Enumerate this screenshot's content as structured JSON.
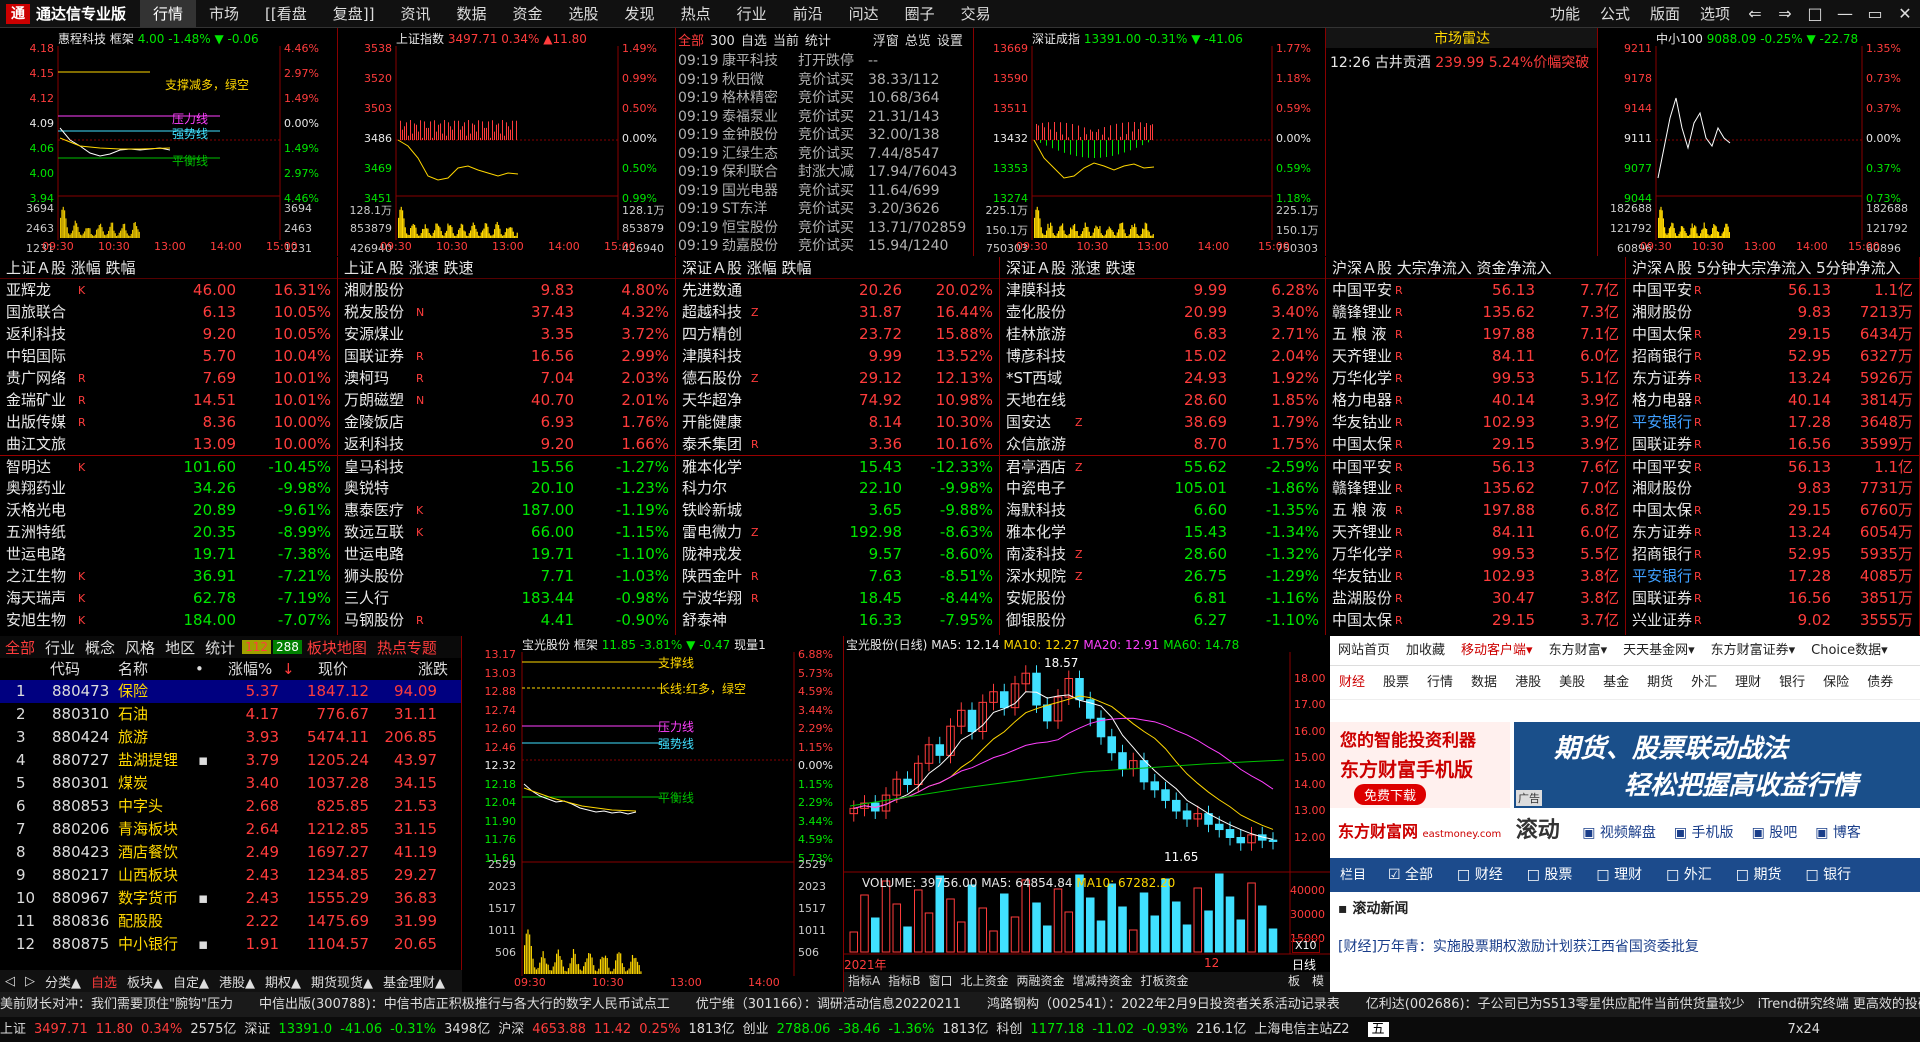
{
  "app": {
    "name": "通达信专业版"
  },
  "menu": [
    "行情",
    "市场",
    "[[看盘",
    "复盘]]",
    "资讯",
    "数据",
    "资金",
    "选股",
    "发现",
    "热点",
    "行业",
    "前沿",
    "问达",
    "圈子",
    "交易"
  ],
  "right_menu": [
    "功能",
    "公式",
    "版面",
    "选项"
  ],
  "win_buttons": [
    "⇐",
    "⇒",
    "□",
    "—",
    "▭",
    "✕"
  ],
  "panel1": {
    "name": "惠程科技",
    "tag": "框架",
    "price": "4.00",
    "chg": "-1.48%",
    "delta": "▼ -0.06",
    "note1": "支撑减多，绿空",
    "note2": "压力线",
    "note3": "强势线",
    "note4": "平衡线",
    "left_ticks": [
      "4.18",
      "4.15",
      "4.12",
      "4.09",
      "4.06",
      "4.00",
      "3.94",
      "3694",
      "2463",
      "1231"
    ],
    "right_ticks": [
      "4.46%",
      "2.97%",
      "1.49%",
      "0.00%",
      "1.49%",
      "2.97%",
      "4.46%",
      "3694",
      "2463",
      "1231"
    ],
    "times": [
      "09:30",
      "10:30",
      "13:00",
      "14:00",
      "15:00"
    ]
  },
  "panel2": {
    "name": "上证指数",
    "price": "3497.71",
    "chg": "0.34%",
    "delta": "▲11.80",
    "left_ticks": [
      "3538",
      "3520",
      "3503",
      "3486",
      "3469",
      "3451",
      "128.1万",
      "853879",
      "426940"
    ],
    "right_ticks": [
      "1.49%",
      "0.99%",
      "0.50%",
      "0.00%",
      "0.50%",
      "0.99%",
      "128.1万",
      "853879",
      "426940"
    ],
    "times": [
      "09:30",
      "10:30",
      "13:00",
      "14:00",
      "15:00"
    ]
  },
  "panel3": {
    "tabs": [
      "全部",
      "300",
      "自选",
      "当前",
      "统计"
    ],
    "tabs_right": [
      "浮窗",
      "总览",
      "设置"
    ],
    "rows": [
      [
        "09:19",
        "康平科技",
        "打开跌停",
        "--"
      ],
      [
        "09:19",
        "秋田微",
        "竞价试买",
        "38.33/112"
      ],
      [
        "09:19",
        "格林精密",
        "竞价试买",
        "10.68/364"
      ],
      [
        "09:19",
        "泰福泵业",
        "竞价试买",
        "21.31/143"
      ],
      [
        "09:19",
        "金钟股份",
        "竞价试买",
        "32.00/138"
      ],
      [
        "09:19",
        "汇绿生态",
        "竞价试买",
        "7.44/8547"
      ],
      [
        "09:19",
        "保利联合",
        "封涨大减",
        "17.94/76043"
      ],
      [
        "09:19",
        "国光电器",
        "竞价试买",
        "11.64/699"
      ],
      [
        "09:19",
        "ST东洋",
        "竞价试买",
        "3.20/3626"
      ],
      [
        "09:19",
        "恒宝股份",
        "竞价试买",
        "13.71/702859"
      ],
      [
        "09:19",
        "劲嘉股份",
        "竞价试买",
        "15.94/1240"
      ]
    ]
  },
  "panel4": {
    "name": "深证成指",
    "price": "13391.00",
    "chg": "-0.31%",
    "delta": "▼ -41.06",
    "left_ticks": [
      "13669",
      "13590",
      "13511",
      "13432",
      "13353",
      "13274",
      "225.1万",
      "150.1万",
      "750303"
    ],
    "right_ticks": [
      "1.77%",
      "1.18%",
      "0.59%",
      "0.00%",
      "0.59%",
      "1.18%",
      "225.1万",
      "150.1万",
      "750303"
    ],
    "times": [
      "09:30",
      "10:30",
      "13:00",
      "14:00",
      "15:00"
    ]
  },
  "panel5": {
    "title": "市场雷达",
    "time": "12:26",
    "name": "古井贡酒",
    "price": "239.99",
    "event": "5.24%价幅突破"
  },
  "panel6": {
    "name": "中小100",
    "price": "9088.09",
    "chg": "-0.25%",
    "delta": "▼ -22.78",
    "left_ticks": [
      "9211",
      "9178",
      "9144",
      "9111",
      "9077",
      "9044",
      "182688",
      "121792",
      "60896"
    ],
    "right_ticks": [
      "1.35%",
      "0.73%",
      "0.37%",
      "0.00%",
      "0.37%",
      "0.73%",
      "182688",
      "121792",
      "60896"
    ],
    "times": [
      "09:30",
      "10:30",
      "13:00",
      "14:00",
      "15:00"
    ]
  },
  "tables": [
    {
      "title": "上证Ａ股 涨幅 跌幅",
      "rows": [
        [
          "亚辉龙",
          "K",
          "46.00",
          "16.31%"
        ],
        [
          "国旅联合",
          "",
          "6.13",
          "10.05%"
        ],
        [
          "返利科技",
          "",
          "9.20",
          "10.05%"
        ],
        [
          "中铝国际",
          "",
          "5.70",
          "10.04%"
        ],
        [
          "贵广网络",
          "R",
          "7.69",
          "10.01%"
        ],
        [
          "金瑞矿业",
          "R",
          "14.51",
          "10.01%"
        ],
        [
          "出版传媒",
          "R",
          "8.36",
          "10.00%"
        ],
        [
          "曲江文旅",
          "",
          "13.09",
          "10.00%"
        ],
        [
          "智明达",
          "K",
          "101.60",
          "-10.45%"
        ],
        [
          "奥翔药业",
          "",
          "34.26",
          "-9.98%"
        ],
        [
          "沃格光电",
          "",
          "20.89",
          "-9.61%"
        ],
        [
          "五洲特纸",
          "",
          "20.35",
          "-8.99%"
        ],
        [
          "世运电路",
          "",
          "19.71",
          "-7.38%"
        ],
        [
          "之江生物",
          "K",
          "36.91",
          "-7.21%"
        ],
        [
          "海天瑞声",
          "K",
          "62.78",
          "-7.19%"
        ],
        [
          "安旭生物",
          "K",
          "184.00",
          "-7.07%"
        ]
      ]
    },
    {
      "title": "上证Ａ股 涨速 跌速",
      "rows": [
        [
          "湘财股份",
          "",
          "9.83",
          "4.80%"
        ],
        [
          "税友股份",
          "N",
          "37.43",
          "4.32%"
        ],
        [
          "安源煤业",
          "",
          "3.35",
          "3.72%"
        ],
        [
          "国联证券",
          "R",
          "16.56",
          "2.99%"
        ],
        [
          "澳柯玛",
          "R",
          "7.04",
          "2.03%"
        ],
        [
          "万朗磁塑",
          "N",
          "40.70",
          "2.01%"
        ],
        [
          "金陵饭店",
          "",
          "6.93",
          "1.76%"
        ],
        [
          "返利科技",
          "",
          "9.20",
          "1.66%"
        ],
        [
          "皇马科技",
          "",
          "15.56",
          "-1.27%"
        ],
        [
          "奥锐特",
          "",
          "20.10",
          "-1.23%"
        ],
        [
          "惠泰医疗",
          "K",
          "187.00",
          "-1.19%"
        ],
        [
          "致远互联",
          "K",
          "66.00",
          "-1.15%"
        ],
        [
          "世运电路",
          "",
          "19.71",
          "-1.10%"
        ],
        [
          "狮头股份",
          "",
          "7.71",
          "-1.03%"
        ],
        [
          "三人行",
          "",
          "183.44",
          "-0.98%"
        ],
        [
          "马钢股份",
          "R",
          "4.41",
          "-0.90%"
        ]
      ]
    },
    {
      "title": "深证Ａ股 涨幅 跌幅",
      "rows": [
        [
          "先进数通",
          "",
          "20.26",
          "20.02%"
        ],
        [
          "超越科技",
          "Z",
          "31.87",
          "16.44%"
        ],
        [
          "四方精创",
          "",
          "23.72",
          "15.88%"
        ],
        [
          "津膜科技",
          "",
          "9.99",
          "13.52%"
        ],
        [
          "德石股份",
          "Z",
          "29.12",
          "12.13%"
        ],
        [
          "天华超净",
          "",
          "74.92",
          "10.98%"
        ],
        [
          "开能健康",
          "",
          "8.14",
          "10.30%"
        ],
        [
          "泰禾集团",
          "R",
          "3.36",
          "10.16%"
        ],
        [
          "雅本化学",
          "",
          "15.43",
          "-12.33%"
        ],
        [
          "科力尔",
          "",
          "22.10",
          "-9.98%"
        ],
        [
          "铁岭新城",
          "",
          "3.65",
          "-9.88%"
        ],
        [
          "雷电微力",
          "Z",
          "192.98",
          "-8.63%"
        ],
        [
          "陇神戎发",
          "",
          "9.57",
          "-8.60%"
        ],
        [
          "陕西金叶",
          "R",
          "7.63",
          "-8.51%"
        ],
        [
          "宁波华翔",
          "R",
          "18.45",
          "-8.44%"
        ],
        [
          "舒泰神",
          "",
          "16.33",
          "-7.95%"
        ]
      ]
    },
    {
      "title": "深证Ａ股 涨速 跌速",
      "rows": [
        [
          "津膜科技",
          "",
          "9.99",
          "6.28%"
        ],
        [
          "壶化股份",
          "",
          "20.99",
          "3.40%"
        ],
        [
          "桂林旅游",
          "",
          "6.83",
          "2.71%"
        ],
        [
          "博彦科技",
          "",
          "15.02",
          "2.04%"
        ],
        [
          "*ST西域",
          "",
          "24.93",
          "1.92%"
        ],
        [
          "天地在线",
          "",
          "28.60",
          "1.85%"
        ],
        [
          "国安达",
          "Z",
          "38.69",
          "1.79%"
        ],
        [
          "众信旅游",
          "",
          "8.70",
          "1.75%"
        ],
        [
          "君亭酒店",
          "Z",
          "55.62",
          "-2.59%"
        ],
        [
          "中瓷电子",
          "",
          "105.01",
          "-1.86%"
        ],
        [
          "海默科技",
          "",
          "6.60",
          "-1.35%"
        ],
        [
          "雅本化学",
          "",
          "15.43",
          "-1.34%"
        ],
        [
          "南凌科技",
          "Z",
          "28.60",
          "-1.32%"
        ],
        [
          "深水规院",
          "Z",
          "26.75",
          "-1.29%"
        ],
        [
          "安妮股份",
          "",
          "6.81",
          "-1.16%"
        ],
        [
          "御银股份",
          "",
          "6.27",
          "-1.10%"
        ]
      ]
    },
    {
      "title": "沪深Ａ股 大宗净流入 资金净流入",
      "rows": [
        [
          "中国平安",
          "R",
          "56.13",
          "7.7亿"
        ],
        [
          "赣锋锂业",
          "R",
          "135.62",
          "7.3亿"
        ],
        [
          "五 粮 液",
          "R",
          "197.88",
          "7.1亿"
        ],
        [
          "天齐锂业",
          "R",
          "84.11",
          "6.0亿"
        ],
        [
          "万华化学",
          "R",
          "99.53",
          "5.1亿"
        ],
        [
          "格力电器",
          "R",
          "40.14",
          "3.9亿"
        ],
        [
          "华友钴业",
          "R",
          "102.93",
          "3.9亿"
        ],
        [
          "中国太保",
          "R",
          "29.15",
          "3.9亿"
        ],
        [
          "中国平安",
          "R",
          "56.13",
          "7.6亿"
        ],
        [
          "赣锋锂业",
          "R",
          "135.62",
          "7.0亿"
        ],
        [
          "五 粮 液",
          "R",
          "197.88",
          "6.8亿"
        ],
        [
          "天齐锂业",
          "R",
          "84.11",
          "6.0亿"
        ],
        [
          "万华化学",
          "R",
          "99.53",
          "5.5亿"
        ],
        [
          "华友钴业",
          "R",
          "102.93",
          "3.8亿"
        ],
        [
          "盐湖股份",
          "R",
          "30.47",
          "3.8亿"
        ],
        [
          "中国太保",
          "R",
          "29.15",
          "3.7亿"
        ]
      ]
    },
    {
      "title": "沪深Ａ股 5分钟大宗净流入 5分钟净流入",
      "rows": [
        [
          "中国平安",
          "R",
          "56.13",
          "1.1亿"
        ],
        [
          "湘财股份",
          "",
          "9.83",
          "7213万"
        ],
        [
          "中国太保",
          "R",
          "29.15",
          "6434万"
        ],
        [
          "招商银行",
          "R",
          "52.95",
          "6327万"
        ],
        [
          "东方证券",
          "R",
          "13.24",
          "5926万"
        ],
        [
          "格力电器",
          "R",
          "40.14",
          "3814万"
        ],
        [
          "平安银行",
          "R",
          "17.28",
          "3648万"
        ],
        [
          "国联证券",
          "R",
          "16.56",
          "3599万"
        ],
        [
          "中国平安",
          "R",
          "56.13",
          "1.1亿"
        ],
        [
          "湘财股份",
          "",
          "9.83",
          "7731万"
        ],
        [
          "中国太保",
          "R",
          "29.15",
          "6760万"
        ],
        [
          "东方证券",
          "R",
          "13.24",
          "6054万"
        ],
        [
          "招商银行",
          "R",
          "52.95",
          "5935万"
        ],
        [
          "平安银行",
          "R",
          "17.28",
          "4085万"
        ],
        [
          "国联证券",
          "R",
          "16.56",
          "3851万"
        ],
        [
          "兴业证券",
          "R",
          "9.02",
          "3555万"
        ]
      ]
    }
  ],
  "sector": {
    "tabs": [
      "全部",
      "行业",
      "概念",
      "风格",
      "地区",
      "统计"
    ],
    "badge": "112",
    "badge2": "288",
    "tabs2": [
      "板块地图",
      "热点专题"
    ],
    "headers": [
      "代码",
      "名称",
      "•",
      "涨幅%",
      "↓",
      "现价",
      "涨跌"
    ],
    "rows": [
      [
        "1",
        "880473",
        "保险",
        "",
        "5.37",
        "1847.12",
        "94.09"
      ],
      [
        "2",
        "880310",
        "石油",
        "",
        "4.17",
        "776.67",
        "31.11"
      ],
      [
        "3",
        "880424",
        "旅游",
        "",
        "3.93",
        "5474.11",
        "206.85"
      ],
      [
        "4",
        "880727",
        "盐湖提锂",
        "▪",
        "3.79",
        "1205.24",
        "43.97"
      ],
      [
        "5",
        "880301",
        "煤炭",
        "",
        "3.40",
        "1037.28",
        "34.15"
      ],
      [
        "6",
        "880853",
        "中字头",
        "",
        "2.68",
        "825.85",
        "21.53"
      ],
      [
        "7",
        "880206",
        "青海板块",
        "",
        "2.64",
        "1212.85",
        "31.15"
      ],
      [
        "8",
        "880423",
        "酒店餐饮",
        "",
        "2.49",
        "1697.27",
        "41.19"
      ],
      [
        "9",
        "880217",
        "山西板块",
        "",
        "2.43",
        "1234.85",
        "29.27"
      ],
      [
        "10",
        "880967",
        "数字货币",
        "▪",
        "2.43",
        "1555.29",
        "36.83"
      ],
      [
        "11",
        "880836",
        "配股股",
        "",
        "2.22",
        "1475.69",
        "31.99"
      ],
      [
        "12",
        "880875",
        "中小银行",
        "▪",
        "1.91",
        "1104.57",
        "20.65"
      ]
    ]
  },
  "bottabs": [
    "◁",
    "▷",
    "分类▲",
    "自选",
    "板块▲",
    "自定▲",
    "港股▲",
    "期权▲",
    "期货现货▲",
    "基金理财▲"
  ],
  "minute": {
    "name": "宝光股份",
    "tag": "框架",
    "price": "11.85",
    "chg": "-3.81%",
    "delta": "▼ -0.47",
    "extra": "现量1",
    "notes": [
      "支撑线",
      "长线:红多，绿空",
      "压力线",
      "强势线",
      "平衡线"
    ],
    "left_ticks": [
      "13.17",
      "13.03",
      "12.88",
      "12.74",
      "12.60",
      "12.46",
      "12.32",
      "12.18",
      "12.04",
      "11.90",
      "11.76",
      "11.61",
      "2529",
      "2023",
      "1517",
      "1011",
      "506"
    ],
    "right_ticks": [
      "6.88%",
      "5.73%",
      "4.59%",
      "3.44%",
      "2.29%",
      "1.15%",
      "0.00%",
      "1.15%",
      "2.29%",
      "3.44%",
      "4.59%",
      "5.73%",
      "2529",
      "2023",
      "1517",
      "1011",
      "506"
    ],
    "times": [
      "09:30",
      "10:30",
      "13:00",
      "14:00"
    ]
  },
  "kline": {
    "name": "宝光股份(日线)",
    "ma5": "MA5: 12.14",
    "ma10": "MA10: 12.27",
    "ma20": "MA20: 12.91",
    "ma60": "MA60: 14.78",
    "high": "18.57",
    "low": "11.65",
    "ticks": [
      "18.00",
      "17.00",
      "16.00",
      "15.00",
      "14.00",
      "13.00",
      "12.00"
    ],
    "vol": "VOLUME: 39756.00",
    "vma5": "MA5: 64854.84",
    "vma10": "MA10: 67282.20",
    "vticks": [
      "40000",
      "30000",
      "15000"
    ],
    "vunit": "X10",
    "year": "2021年",
    "month": "12",
    "days": [
      "日线"
    ],
    "tabs": [
      "指标A",
      "指标B",
      "窗口",
      "北上资金",
      "两融资金",
      "增减持资金",
      "打板资金"
    ],
    "tabs_right": [
      "模",
      "板"
    ],
    "chart_data": {
      "type": "line",
      "closes": [
        13.1,
        13.3,
        13.0,
        13.6,
        14.2,
        14.0,
        14.8,
        15.5,
        15.1,
        16.2,
        16.8,
        16.0,
        17.1,
        17.5,
        16.9,
        17.8,
        18.2,
        17.0,
        16.4,
        17.3,
        18.0,
        17.2,
        16.5,
        15.8,
        15.2,
        14.6,
        14.9,
        14.1,
        13.8,
        13.4,
        13.0,
        12.7,
        12.9,
        12.5,
        12.3,
        12.0,
        11.8,
        12.1,
        11.9,
        11.85
      ]
    }
  },
  "web": {
    "nav": [
      "网站首页",
      "加收藏",
      "移动客户端▾",
      "东方财富▾",
      "天天基金网▾",
      "东方财富证券▾",
      "Choice数据▾"
    ],
    "nav2": [
      "财经",
      "股票",
      "行情",
      "数据",
      "港股",
      "美股",
      "基金",
      "期货",
      "外汇",
      "理财",
      "银行",
      "保险",
      "债券"
    ],
    "ad1a": "您的智能投资利器",
    "ad1b": "东方财富手机版",
    "ad1c": "免费下载",
    "ad1d": "广告",
    "ad2a": "期货、股票联动战法",
    "ad2b": "轻松把握高收益行情",
    "ad2c": "广告",
    "brand": "东方财富网",
    "brand_sub": "eastmoney.com",
    "scroll": "滚动",
    "links": [
      "视频解盘",
      "手机版",
      "股吧",
      "博客"
    ],
    "filter": [
      "栏目",
      "全部",
      "财经",
      "股票",
      "理财",
      "外汇",
      "期货",
      "银行"
    ],
    "news_title": "滚动新闻",
    "news1": "[财经]万年青：实施股票期权激励计划获江西省国资委批复"
  },
  "ticker": "美前财长对冲：我们需要顶住\"腕钩\"压力　　中信出版(300788)：中信书店正积极推行与各大行的数字人民币试点工　　优宁维（301166）：调研活动信息20220211　　鸿路钢构（002541）：2022年2月9日投资者关系活动记录表　　亿利达(002686)：子公司已为S513零星供应配件当前供货量较少　iTrend研究终端 更高效的投研环境",
  "status": {
    "sh_label": "上证",
    "sh": "3497.71",
    "sh_d": "11.80",
    "sh_p": "0.34%",
    "sh_v": "2575亿",
    "sz_label": "深证",
    "sz": "13391.0",
    "sz_d": "-41.06",
    "sz_p": "-0.31%",
    "sz_v": "3498亿",
    "hs_label": "沪深",
    "hs": "4653.88",
    "hs_d": "11.42",
    "hs_p": "0.25%",
    "hs_v": "1813亿",
    "cy_label": "创业",
    "cy": "2788.06",
    "cy_d": "-38.46",
    "cy_p": "-1.36%",
    "cy_v": "1813亿",
    "kc_label": "科创",
    "kc": "1177.18",
    "kc_d": "-11.02",
    "kc_p": "-0.93%",
    "kc_v": "216.1亿",
    "server": "上海电信主站Z2",
    "ime": "五",
    "clock": "7x24"
  }
}
